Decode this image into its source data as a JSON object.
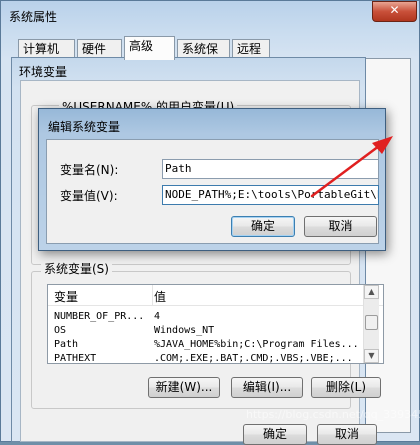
{
  "sysprops": {
    "title": "系统属性",
    "close_glyph": "✕",
    "tabs": [
      {
        "label": "计算机名"
      },
      {
        "label": "硬件"
      },
      {
        "label": "高级"
      },
      {
        "label": "系统保护"
      },
      {
        "label": "远程"
      }
    ],
    "ok_label": "确定",
    "cancel_label": "取消"
  },
  "envvars": {
    "title": "环境变量",
    "user_group_label": "%USERNAME% 的用户变量(U)",
    "system_group_label": "系统变量(S)",
    "columns": [
      "变量",
      "值"
    ],
    "rows": [
      {
        "name": "NUMBER_OF_PR...",
        "value": "4"
      },
      {
        "name": "OS",
        "value": "Windows_NT"
      },
      {
        "name": "Path",
        "value": "%JAVA_HOME%bin;C:\\Program Files..."
      },
      {
        "name": "PATHEXT",
        "value": ".COM;.EXE;.BAT;.CMD;.VBS;.VBE;..."
      }
    ],
    "new_label": "新建(W)...",
    "edit_label": "编辑(I)...",
    "delete_label": "删除(L)",
    "ok_label": "确定",
    "cancel_label": "取消"
  },
  "edit_dialog": {
    "title": "编辑系统变量",
    "name_label": "变量名(N):",
    "name_value": "Path",
    "value_label": "变量值(V):",
    "value_value": "NODE_PATH%;E:\\tools\\PortableGit\\bin",
    "ok_label": "确定",
    "cancel_label": "取消",
    "annotation_color": "#e02020"
  },
  "watermark": "https://blog.csdn.net/qq_33934533"
}
